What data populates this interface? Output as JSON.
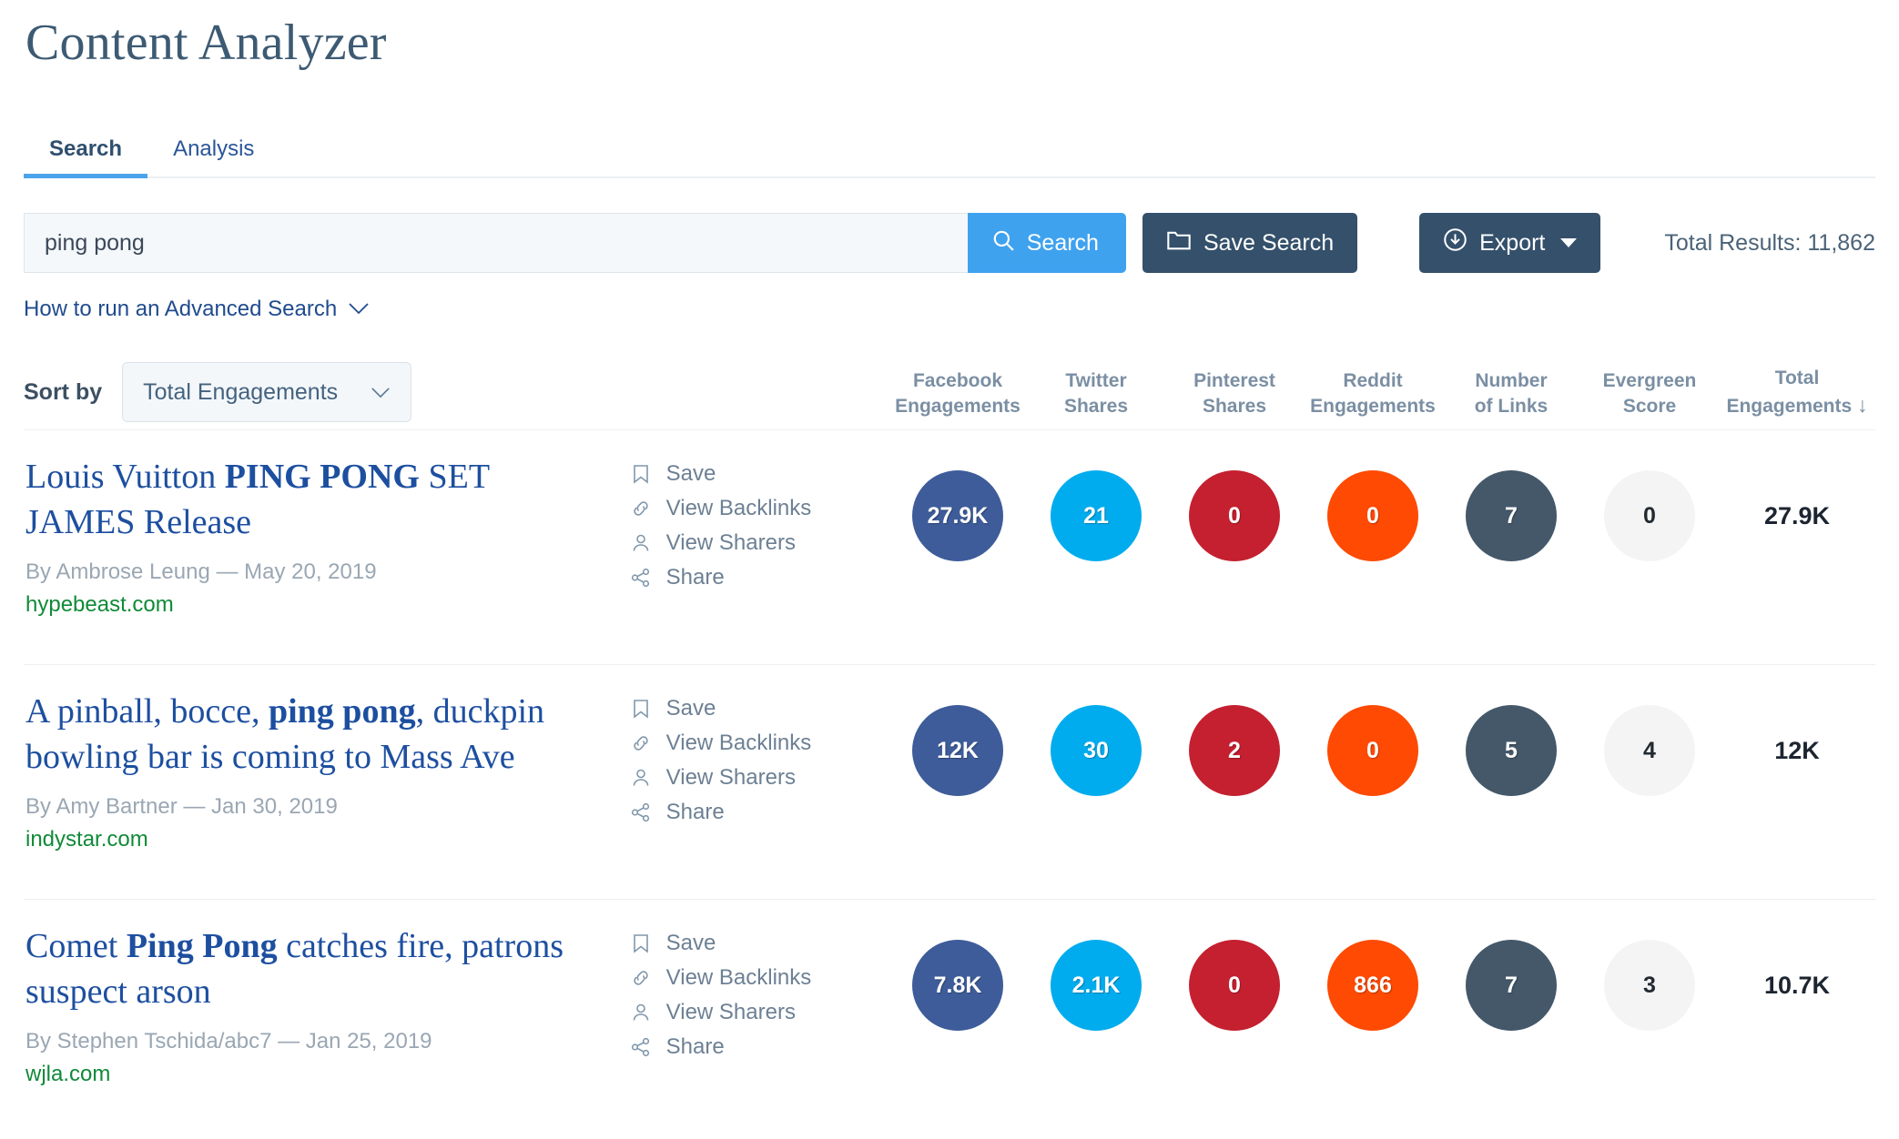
{
  "header": {
    "title": "Content Analyzer"
  },
  "tabs": [
    {
      "label": "Search",
      "active": true
    },
    {
      "label": "Analysis",
      "active": false
    }
  ],
  "search": {
    "value": "ping pong",
    "placeholder": "",
    "search_button": "Search",
    "save_button": "Save Search",
    "export_button": "Export",
    "total_results": "Total Results: 11,862",
    "advanced_link": "How to run an Advanced Search"
  },
  "sort": {
    "label": "Sort by",
    "selected": "Total Engagements"
  },
  "columns": [
    {
      "line1": "Facebook",
      "line2": "Engagements",
      "key": "facebook"
    },
    {
      "line1": "Twitter",
      "line2": "Shares",
      "key": "twitter"
    },
    {
      "line1": "Pinterest",
      "line2": "Shares",
      "key": "pinterest"
    },
    {
      "line1": "Reddit",
      "line2": "Engagements",
      "key": "reddit"
    },
    {
      "line1": "Number",
      "line2": "of Links",
      "key": "links"
    },
    {
      "line1": "Evergreen",
      "line2": "Score",
      "key": "evergreen"
    },
    {
      "line1": "Total",
      "line2": "Engagements",
      "key": "total",
      "sort_arrow": "↓"
    }
  ],
  "colors": {
    "facebook": "#3e5c9a",
    "twitter": "#00acee",
    "pinterest": "#c4202f",
    "reddit": "#fe4a02",
    "links": "#44586a",
    "evergreen": "#f4f4f4",
    "accent_blue": "#3fa2ef",
    "dark_navy": "#34506b",
    "domain_green": "#108a38"
  },
  "actions": [
    {
      "label": "Save",
      "icon": "bookmark-icon"
    },
    {
      "label": "View Backlinks",
      "icon": "link-icon"
    },
    {
      "label": "View Sharers",
      "icon": "person-icon"
    },
    {
      "label": "Share",
      "icon": "share-nodes-icon"
    }
  ],
  "results": [
    {
      "title_parts": [
        {
          "text": "Louis Vuitton ",
          "bold": false
        },
        {
          "text": "PING PONG",
          "bold": true
        },
        {
          "text": " SET JAMES Release",
          "bold": false
        }
      ],
      "byline": "By Ambrose Leung — May 20, 2019",
      "domain": "hypebeast.com",
      "facebook": "27.9K",
      "twitter": "21",
      "pinterest": "0",
      "reddit": "0",
      "links": "7",
      "evergreen": "0",
      "total": "27.9K"
    },
    {
      "title_parts": [
        {
          "text": "A pinball, bocce, ",
          "bold": false
        },
        {
          "text": "ping pong",
          "bold": true
        },
        {
          "text": ", duckpin bowling bar is coming to Mass Ave",
          "bold": false
        }
      ],
      "byline": "By Amy Bartner — Jan 30, 2019",
      "domain": "indystar.com",
      "facebook": "12K",
      "twitter": "30",
      "pinterest": "2",
      "reddit": "0",
      "links": "5",
      "evergreen": "4",
      "total": "12K"
    },
    {
      "title_parts": [
        {
          "text": "Comet ",
          "bold": false
        },
        {
          "text": "Ping Pong",
          "bold": true
        },
        {
          "text": " catches fire, patrons suspect arson",
          "bold": false
        }
      ],
      "byline": "By Stephen Tschida/abc7 — Jan 25, 2019",
      "domain": "wjla.com",
      "facebook": "7.8K",
      "twitter": "2.1K",
      "pinterest": "0",
      "reddit": "866",
      "links": "7",
      "evergreen": "3",
      "total": "10.7K"
    }
  ]
}
